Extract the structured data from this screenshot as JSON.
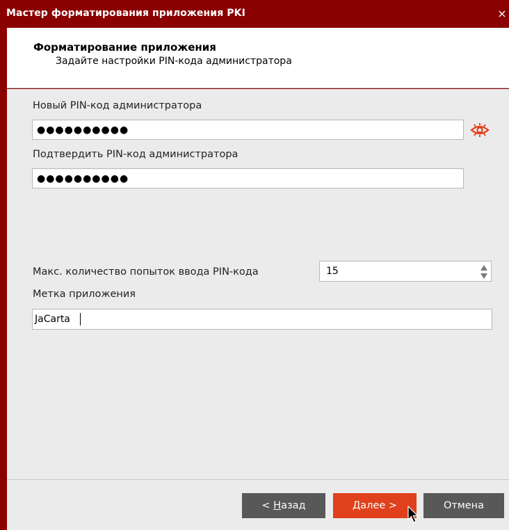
{
  "window": {
    "title": "Мастер форматирования приложения PKI",
    "close_glyph": "×"
  },
  "header": {
    "title": "Форматирование приложения",
    "subtitle": "Задайте настройки PIN-кода администратора"
  },
  "form": {
    "new_pin_label": "Новый PIN-код администратора",
    "new_pin_mask": "●●●●●●●●●●",
    "confirm_pin_label": "Подтвердить PIN-код администратора",
    "confirm_pin_mask": "●●●●●●●●●●",
    "max_attempts_label": "Макс. количество попыток ввода PIN-кода",
    "max_attempts_value": "15",
    "app_label_label": "Метка приложения",
    "app_label_value": "JaCarta"
  },
  "buttons": {
    "back_prefix": "< ",
    "back_mnemonic": "Н",
    "back_rest": "азад",
    "next_mnemonic": "Д",
    "next_rest": "алее >",
    "cancel": "Отмена"
  },
  "icons": {
    "show_password": "eye-icon",
    "spinner": "spin-up-down-icon",
    "mouse_cursor": "pointer-cursor-icon"
  },
  "colors": {
    "title_bar": "#8b0000",
    "accent": "#e0401b",
    "secondary_button": "#585858",
    "panel": "#ebebeb"
  }
}
